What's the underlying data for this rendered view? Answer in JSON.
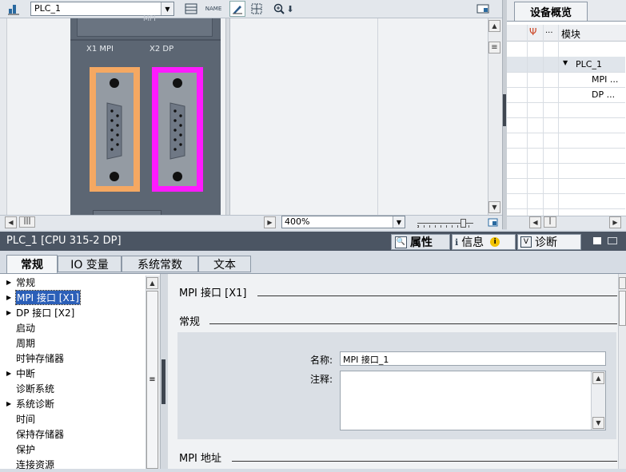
{
  "toolbar": {
    "device_select": "PLC_1"
  },
  "device": {
    "port1_label": "X1 MPI",
    "port2_label": "X2 DP",
    "top_label": "MPI"
  },
  "zoom": "400%",
  "overview": {
    "tab_label": "设备概览",
    "col_dots": "...",
    "col_module": "模块",
    "rows": [
      {
        "label": "PLC_1"
      },
      {
        "label": "MPI ..."
      },
      {
        "label": "DP ..."
      }
    ]
  },
  "inspector": {
    "title": "PLC_1 [CPU 315-2 DP]",
    "tabs_right": {
      "properties": "属性",
      "info": "信息",
      "diagnostics": "诊断"
    },
    "tabs": [
      "常规",
      "IO 变量",
      "系统常数",
      "文本"
    ],
    "nav": [
      {
        "label": "常规",
        "arrow": "▶"
      },
      {
        "label": "MPI 接口 [X1]",
        "arrow": "▶"
      },
      {
        "label": "DP 接口 [X2]",
        "arrow": "▶"
      },
      {
        "label": "启动",
        "arrow": ""
      },
      {
        "label": "周期",
        "arrow": ""
      },
      {
        "label": "时钟存储器",
        "arrow": ""
      },
      {
        "label": "中断",
        "arrow": "▶"
      },
      {
        "label": "诊断系统",
        "arrow": ""
      },
      {
        "label": "系统诊断",
        "arrow": "▶"
      },
      {
        "label": "时间",
        "arrow": ""
      },
      {
        "label": "保持存储器",
        "arrow": ""
      },
      {
        "label": "保护",
        "arrow": ""
      },
      {
        "label": "连接资源",
        "arrow": ""
      }
    ],
    "section_title": "MPI 接口 [X1]",
    "subsection_general": "常规",
    "name_label": "名称:",
    "name_value": "MPI 接口_1",
    "comment_label": "注释:",
    "subsection_address": "MPI 地址"
  }
}
